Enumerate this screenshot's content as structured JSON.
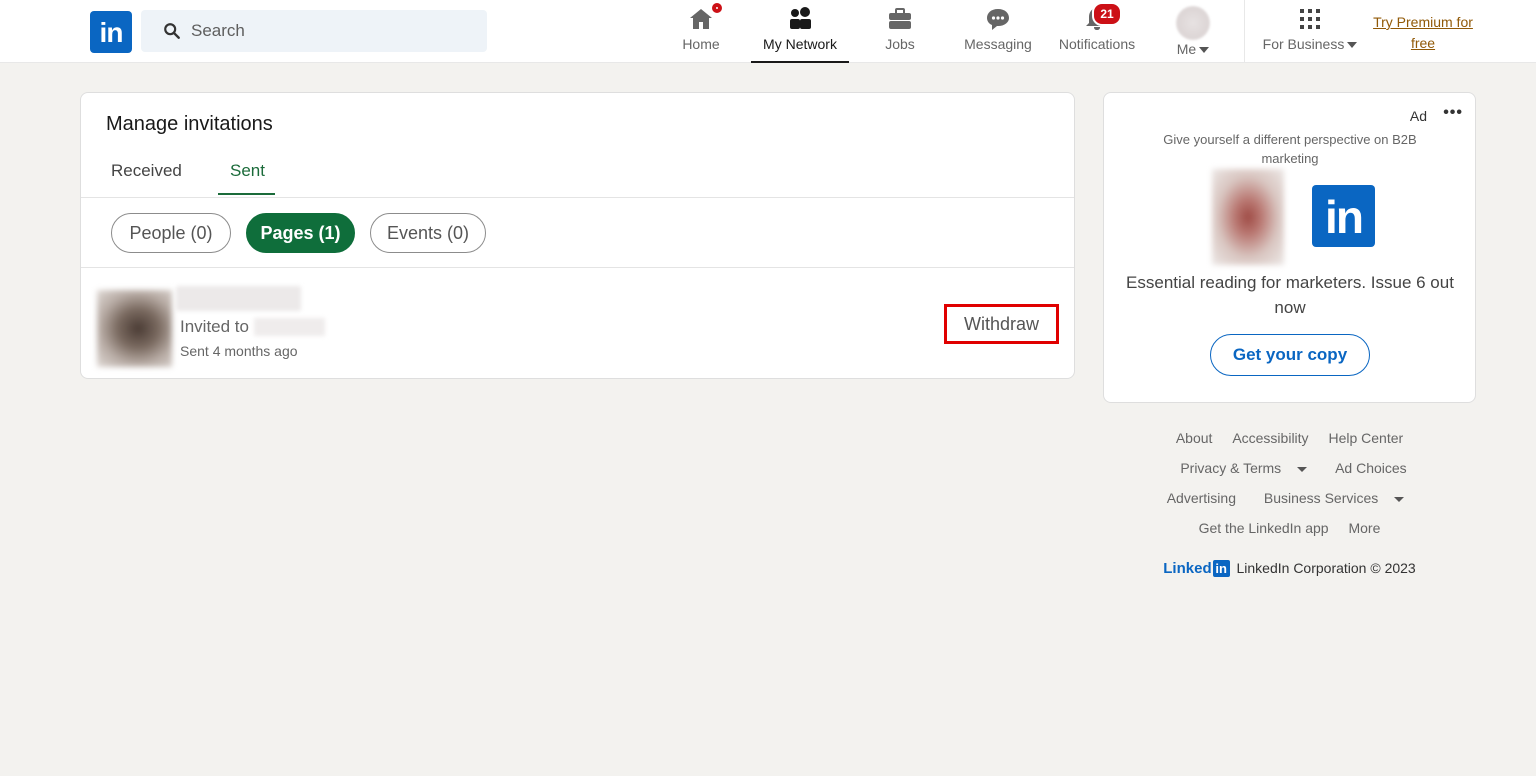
{
  "nav": {
    "logo": "in",
    "search_placeholder": "Search",
    "items": [
      {
        "label": "Home",
        "icon": "home-icon"
      },
      {
        "label": "My Network",
        "icon": "network-icon"
      },
      {
        "label": "Jobs",
        "icon": "briefcase-icon"
      },
      {
        "label": "Messaging",
        "icon": "message-icon"
      },
      {
        "label": "Notifications",
        "icon": "bell-icon",
        "badge": "21"
      },
      {
        "label": "Me"
      },
      {
        "label": "For Business",
        "icon": "grid-icon"
      }
    ],
    "premium": "Try Premium for free"
  },
  "invitations": {
    "title": "Manage invitations",
    "tabs": [
      "Received",
      "Sent"
    ],
    "active_tab": "Sent",
    "filters": [
      "People (0)",
      "Pages (1)",
      "Events (0)"
    ],
    "active_filter": "Pages (1)",
    "item": {
      "invited_to": "Invited to",
      "sent": "Sent 4 months ago",
      "action": "Withdraw"
    }
  },
  "ad": {
    "label": "Ad",
    "menu": "•••",
    "tagline": "Give yourself a different perspective on B2B marketing",
    "logo": "in",
    "headline": "Essential reading for marketers. Issue 6 out now",
    "cta": "Get your copy"
  },
  "footer": {
    "links": [
      "About",
      "Accessibility",
      "Help Center",
      "Privacy & Terms",
      "Ad Choices",
      "Advertising",
      "Business Services",
      "Get the LinkedIn app",
      "More"
    ],
    "brand_word": "Linked",
    "brand_box": "in",
    "copyright": "LinkedIn Corporation © 2023"
  },
  "colors": {
    "brand": "#0a66c2",
    "green_active": "#0f6e3b",
    "alert_red": "#cc1016",
    "highlight_box": "#e00000",
    "premium": "#915907"
  }
}
